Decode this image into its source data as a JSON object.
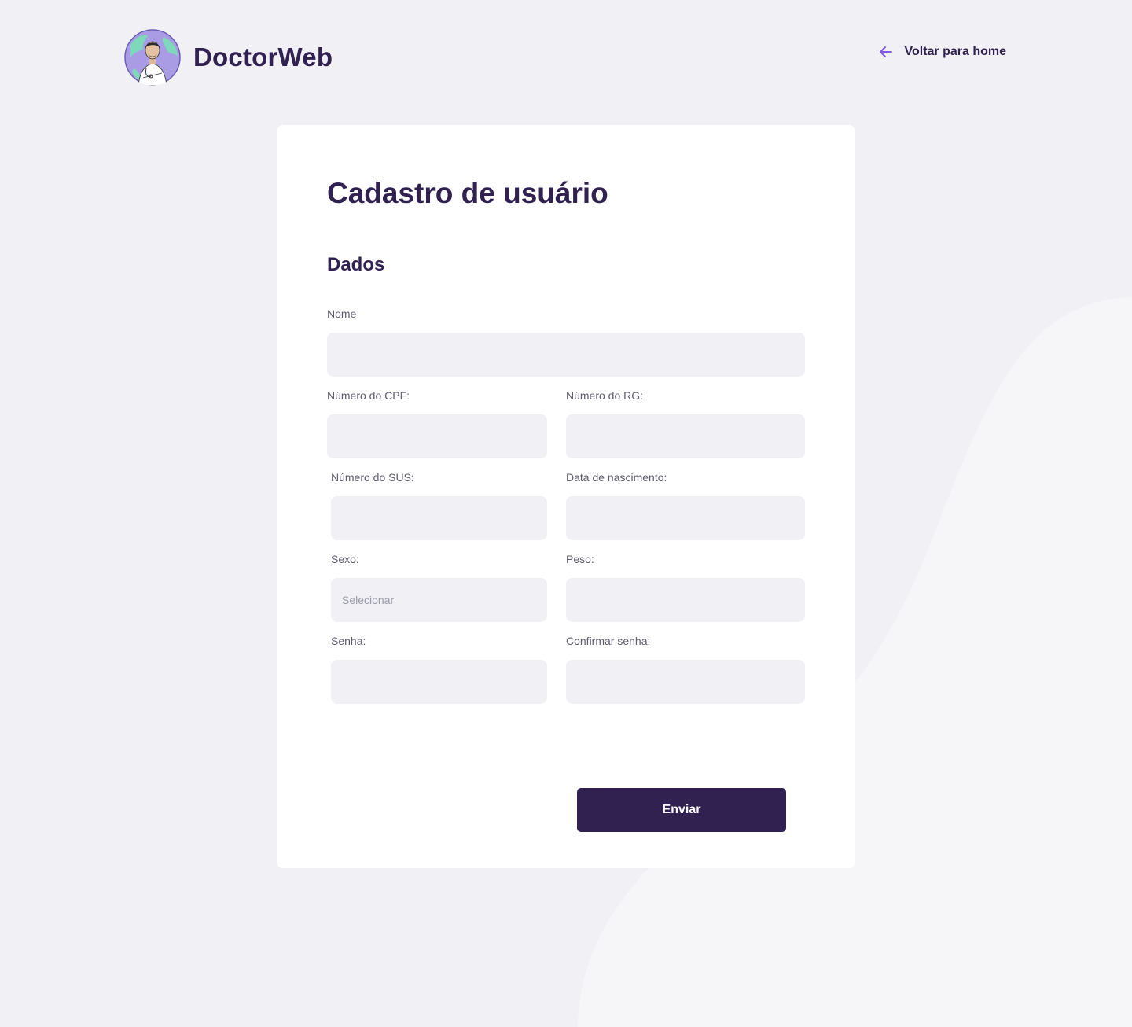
{
  "header": {
    "brand_name": "DoctorWeb",
    "back_label": "Voltar para home",
    "back_icon": "arrow-left-icon",
    "logo_icon": "doctor-avatar"
  },
  "form": {
    "title": "Cadastro de usuário",
    "section_title": "Dados",
    "fields": {
      "nome": {
        "label": "Nome",
        "value": ""
      },
      "cpf": {
        "label": "Número do CPF:",
        "value": ""
      },
      "rg": {
        "label": "Número do RG:",
        "value": ""
      },
      "sus": {
        "label": "Número do SUS:",
        "value": ""
      },
      "nascimento": {
        "label": "Data de nascimento:",
        "value": ""
      },
      "sexo": {
        "label": "Sexo:",
        "placeholder": "Selecionar"
      },
      "peso": {
        "label": "Peso:",
        "value": ""
      },
      "senha": {
        "label": "Senha:",
        "value": ""
      },
      "confirmar_senha": {
        "label": "Confirmar senha:",
        "value": ""
      }
    },
    "submit_label": "Enviar"
  },
  "colors": {
    "background": "#f0f0f5",
    "card": "#ffffff",
    "primary": "#312151",
    "accent": "#8257e5",
    "input_bg": "#f0f0f5",
    "label": "#5c5c70"
  }
}
